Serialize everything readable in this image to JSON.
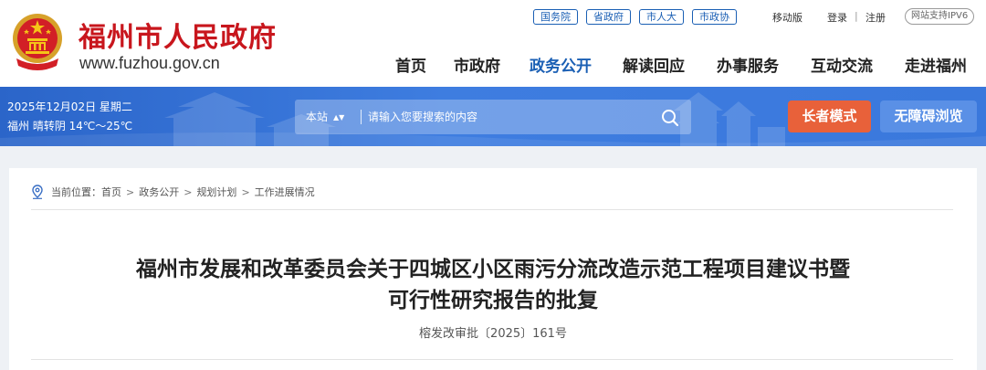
{
  "header": {
    "site_name": "福州市人民政府",
    "site_url": "www.fuzhou.gov.cn",
    "top_links": [
      "国务院",
      "省政府",
      "市人大",
      "市政协"
    ],
    "mobile": "移动版",
    "login": "登录",
    "register": "注册",
    "util_sep": "|",
    "ipv6": "网站支持IPV6"
  },
  "nav": {
    "items": [
      "首页",
      "市政府",
      "政务公开",
      "解读回应",
      "办事服务",
      "互动交流",
      "走进福州"
    ],
    "active": "政务公开"
  },
  "banner": {
    "date": "2025年12月02日 星期二",
    "weather": "福州 晴转阴 14℃～25℃",
    "search_scope": "本站",
    "search_placeholder": "请输入您要搜索的内容",
    "elder_mode": "长者模式",
    "accessible": "无障碍浏览"
  },
  "breadcrumb": {
    "prefix": "当前位置：",
    "items": [
      "首页",
      "政务公开",
      "规划计划",
      "工作进展情况"
    ],
    "separator": ">"
  },
  "article": {
    "title_line1": "福州市发展和改革委员会关于四城区小区雨污分流改造示范工程项目建议书暨",
    "title_line2": "可行性研究报告的批复",
    "doc_number": "榕发改审批〔2025〕161号"
  },
  "colors": {
    "brand_red": "#c8161d",
    "nav_active": "#1a5fb4",
    "banner_blue": "#3a78dc",
    "elder_orange": "#e8613a",
    "access_blue": "#5a90e6"
  }
}
